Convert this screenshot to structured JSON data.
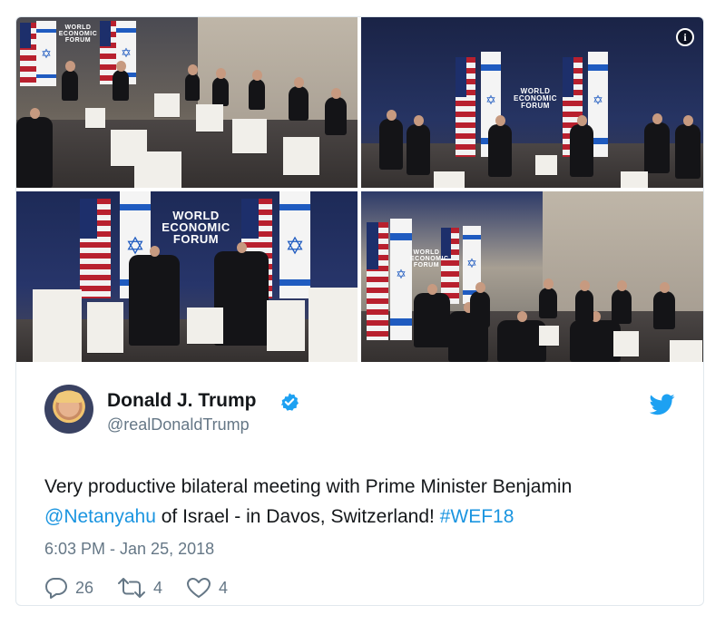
{
  "media": {
    "photos": [
      {
        "logo_lines": [
          "WORLD",
          "ECONOMIC",
          "FORUM"
        ]
      },
      {
        "logo_lines": [
          "WORLD",
          "ECONOMIC",
          "FORUM"
        ]
      },
      {
        "logo_lines": [
          "WORLD",
          "ECONOMIC",
          "FORUM"
        ]
      },
      {
        "logo_lines": [
          "WORLD",
          "ECONOMIC",
          "FORUM"
        ]
      }
    ],
    "info_icon": "info-icon"
  },
  "tweet": {
    "author_name": "Donald J. Trump",
    "handle": "@realDonaldTrump",
    "verified_icon": "verified-badge-icon",
    "brand_icon": "twitter-bird-icon",
    "text_before": "Very productive bilateral meeting with Prime Minister Benjamin ",
    "mention": "@Netanyahu",
    "text_middle": " of Israel - in Davos, Switzerland! ",
    "hashtag": "#WEF18",
    "timestamp": "6:03 PM - Jan 25, 2018",
    "replies": "26",
    "retweets": "4",
    "likes": "4"
  },
  "colors": {
    "link": "#1b95e0",
    "secondary_text": "#657786",
    "border": "#e1e8ed"
  }
}
